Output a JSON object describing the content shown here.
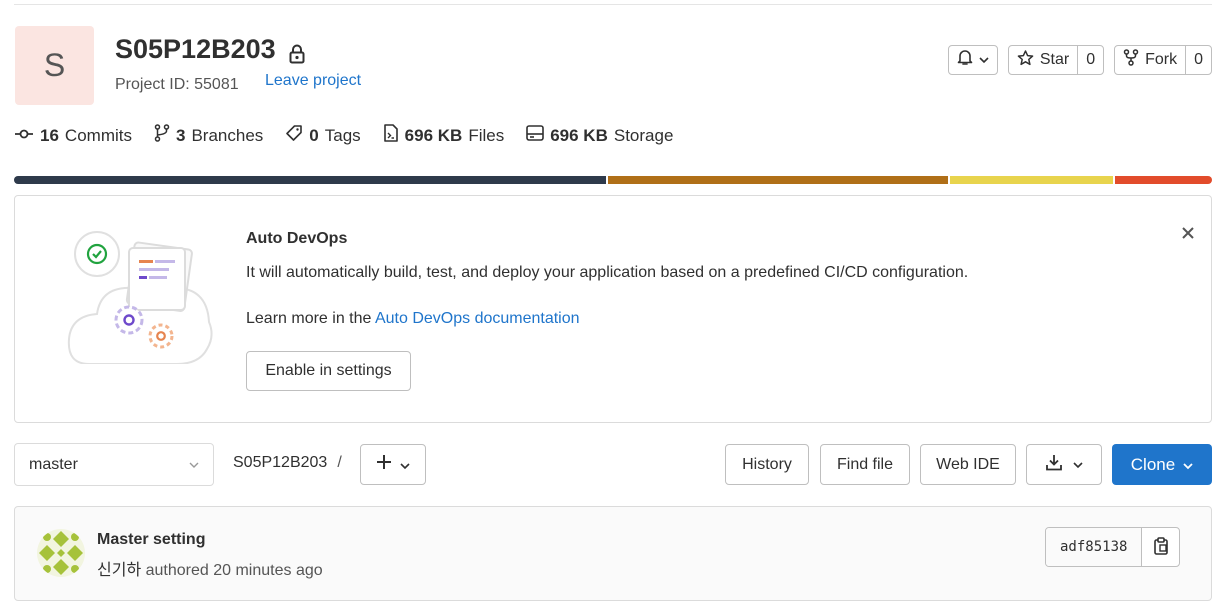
{
  "project": {
    "avatar_letter": "S",
    "name": "S05P12B203",
    "id_text": "Project ID: 55081",
    "leave_label": "Leave project"
  },
  "actions": {
    "star_label": "Star",
    "star_count": "0",
    "fork_label": "Fork",
    "fork_count": "0"
  },
  "stats": {
    "commits_count": "16",
    "commits_label": "Commits",
    "branches_count": "3",
    "branches_label": "Branches",
    "tags_count": "0",
    "tags_label": "Tags",
    "files_size": "696 KB",
    "files_label": "Files",
    "storage_size": "696 KB",
    "storage_label": "Storage"
  },
  "language_bar": [
    {
      "color": "#2e3a4b",
      "share": 0.497
    },
    {
      "color": "#b06f18",
      "share": 0.285
    },
    {
      "color": "#e8d44d",
      "share": 0.137
    },
    {
      "color": "#e24c2b",
      "share": 0.081
    }
  ],
  "devops": {
    "title": "Auto DevOps",
    "description": "It will automatically build, test, and deploy your application based on a predefined CI/CD configuration.",
    "learn_prefix": "Learn more in the ",
    "learn_link": "Auto DevOps documentation",
    "enable_label": "Enable in settings"
  },
  "toolbar": {
    "branch": "master",
    "breadcrumb_root": "S05P12B203",
    "breadcrumb_sep": "/",
    "history_label": "History",
    "find_file_label": "Find file",
    "web_ide_label": "Web IDE",
    "clone_label": "Clone"
  },
  "commit": {
    "message": "Master setting",
    "author": "신기하",
    "authored_text": " authored 20 minutes ago",
    "sha": "adf85138"
  },
  "colors": {
    "accent": "#1f75cb",
    "avatar_bg": "#fbe5e1"
  }
}
